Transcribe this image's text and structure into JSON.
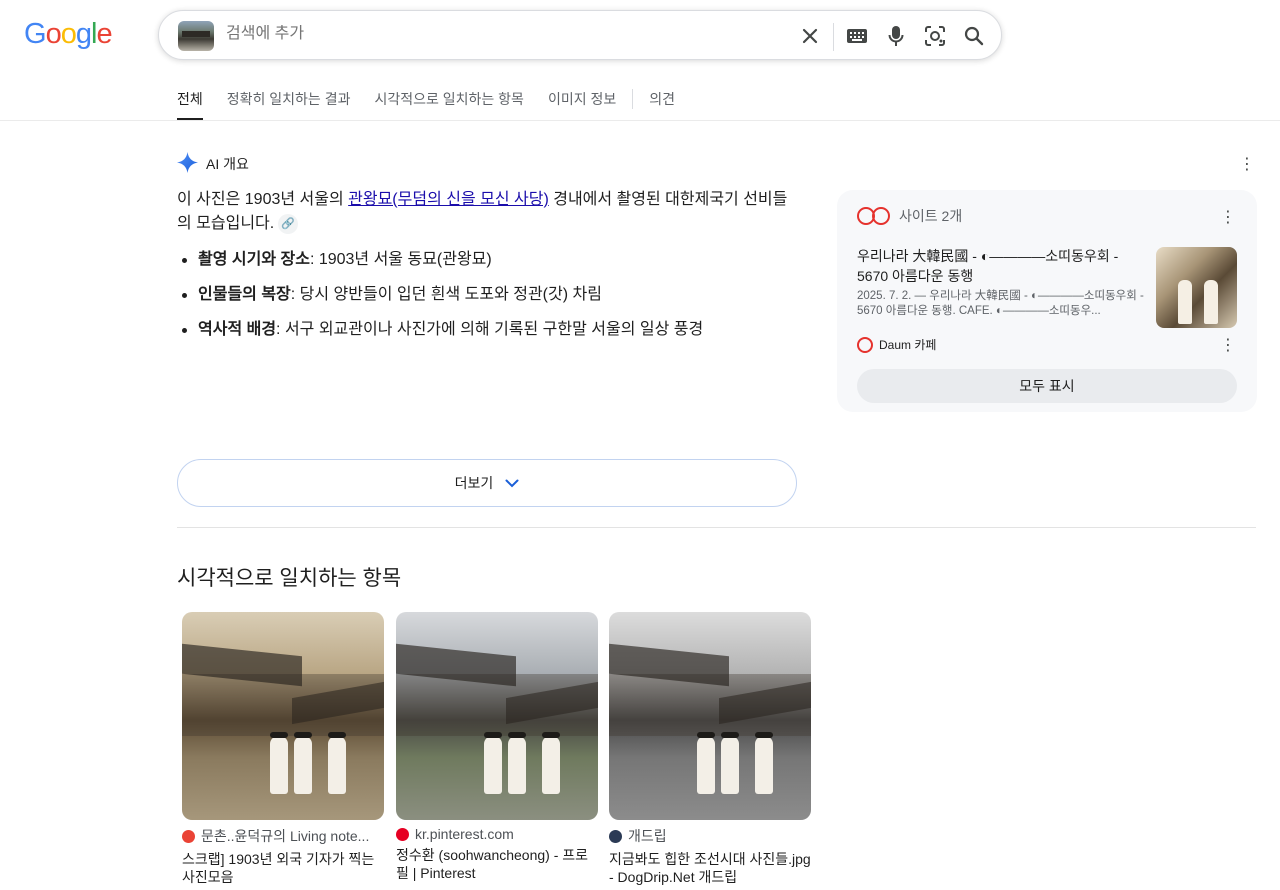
{
  "logo": {
    "letters": [
      "G",
      "o",
      "o",
      "g",
      "l",
      "e"
    ],
    "colors": [
      "#4285F4",
      "#EA4335",
      "#FBBC05",
      "#4285F4",
      "#34A853",
      "#EA4335"
    ]
  },
  "search": {
    "query": "검색에 추가"
  },
  "tabs": [
    {
      "label": "전체",
      "active": true
    },
    {
      "label": "정확히 일치하는 결과"
    },
    {
      "label": "시각적으로 일치하는 항목"
    },
    {
      "label": "이미지 정보"
    },
    {
      "label": "의견"
    }
  ],
  "ai_overview": {
    "heading": "AI 개요",
    "intro_before": "이 사진은 1903년 서울의 ",
    "intro_link": "관왕묘(무덤의 신을 모신 사당)",
    "intro_after": " 경내에서 촬영된 대한제국기 선비들의 모습입니다.",
    "bullets": [
      {
        "term": "촬영 시기와 장소",
        "text": ": 1903년 서울 동묘(관왕묘)"
      },
      {
        "term": "인물들의 복장",
        "text": ": 당시 양반들이 입던 흰색 도포와 정관(갓) 차림"
      },
      {
        "term": "역사적 배경",
        "text": ": 서구 외교관이나 사진가에 의해 기록된 구한말 서울의 일상 풍경"
      }
    ],
    "more_label": "더보기"
  },
  "sources": {
    "heading": "사이트 2개",
    "item": {
      "title": "우리나라 大韓民國 - ◐————소띠동우회 - 5670 아름다운 동행",
      "snippet": "2025. 7. 2. — 우리나라 大韓民國 - ◐————소띠동우회 - 5670 아름다운 동행. CAFE. ◐————소띠동우...",
      "site": "Daum 카페"
    },
    "show_all": "모두 표시"
  },
  "visual_matches": {
    "heading": "시각적으로 일치하는 항목",
    "items": [
      {
        "site": "문촌..윤덕규의 Living note...",
        "caption": "스크랩] 1903년 외국 기자가 찍는 사진모음",
        "favicon_color": "#ea4335"
      },
      {
        "site": "kr.pinterest.com",
        "caption": "정수환 (soohwancheong) - 프로필 | Pinterest",
        "favicon_color": "#e60023"
      },
      {
        "site": "개드립",
        "caption": "지금봐도 힙한 조선시대 사진들.jpg - DogDrip.Net 개드립",
        "favicon_color": "#2b3a55"
      }
    ]
  }
}
